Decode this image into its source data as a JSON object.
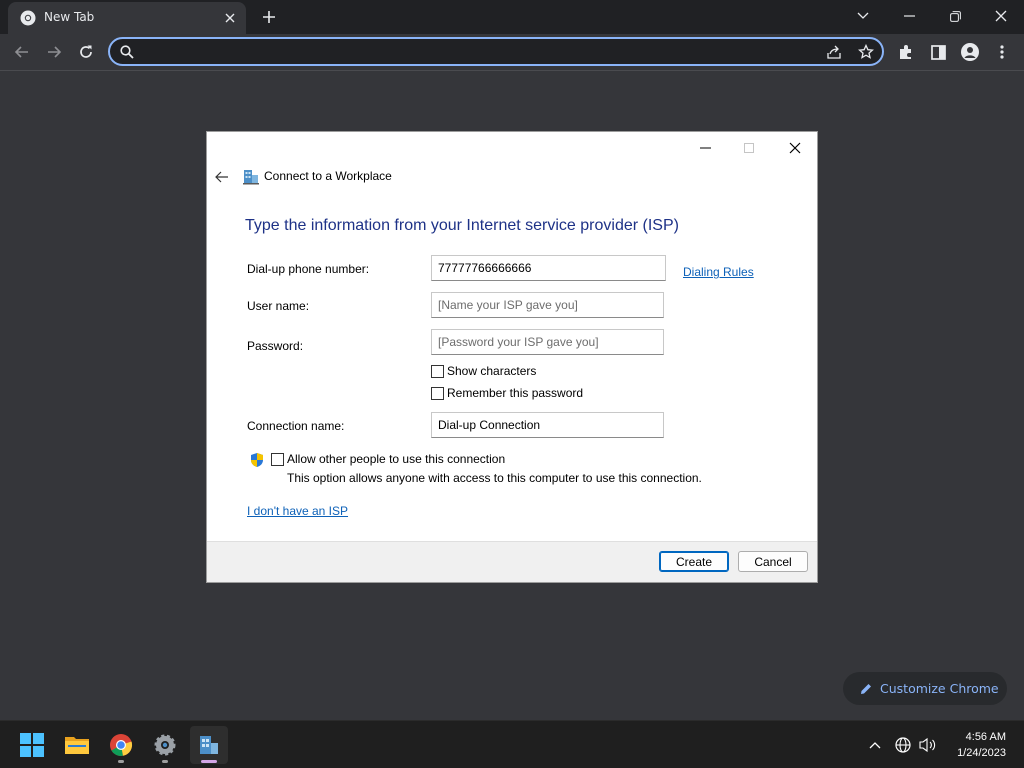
{
  "browser": {
    "tab_title": "New Tab",
    "omnibox_value": "",
    "omnibox_placeholder": "",
    "customize_label": "Customize Chrome"
  },
  "dialog": {
    "window_title": "Connect to a Workplace",
    "heading": "Type the information from your Internet service provider (ISP)",
    "phone_label": "Dial-up phone number:",
    "phone_value": "77777766666666",
    "dialing_rules_link": "Dialing Rules",
    "username_label": "User name:",
    "username_placeholder": "[Name your ISP gave you]",
    "password_label": "Password:",
    "password_placeholder": "[Password your ISP gave you]",
    "show_characters_label": "Show characters",
    "remember_password_label": "Remember this password",
    "connection_name_label": "Connection name:",
    "connection_name_value": "Dial-up Connection",
    "allow_others_label": "Allow other people to use this connection",
    "allow_others_desc": "This option allows anyone with access to this computer to use this connection.",
    "no_isp_link": "I don't have an ISP",
    "create_button": "Create",
    "cancel_button": "Cancel"
  },
  "taskbar": {
    "time": "4:56 AM",
    "date": "1/24/2023"
  },
  "colors": {
    "chrome_dark": "#35363a",
    "accent_blue": "#8ab4f8",
    "dialog_heading": "#1e3287",
    "link": "#0d61b8"
  }
}
